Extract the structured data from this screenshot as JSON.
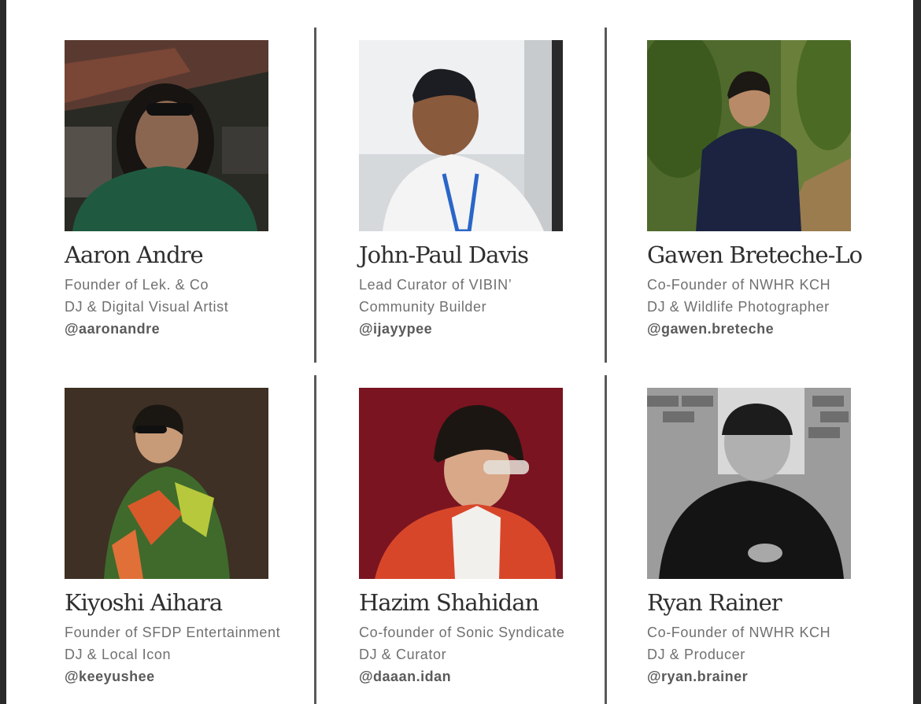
{
  "colors": {
    "page_background": "#ffffff",
    "name_text": "#2f2f2f",
    "role_text": "#707070",
    "handle_text": "#5a5a5a",
    "divider": "#5a5a5a"
  },
  "people": [
    {
      "name": "Aaron Andre",
      "role1": "Founder of Lek. & Co",
      "role2": "DJ & Digital Visual Artist",
      "handle": "@aaronandre"
    },
    {
      "name": "John-Paul Davis",
      "role1": "Lead Curator of VIBIN’",
      "role2": "Community Builder",
      "handle": "@ijayypee"
    },
    {
      "name": "Gawen Breteche-Lo",
      "role1": "Co-Founder of NWHR KCH",
      "role2": "DJ & Wildlife Photographer",
      "handle": "@gawen.breteche"
    },
    {
      "name": "Kiyoshi Aihara",
      "role1": "Founder of SFDP Entertainment",
      "role2": "DJ & Local Icon",
      "handle": "@keeyushee"
    },
    {
      "name": "Hazim Shahidan",
      "role1": "Co-founder of Sonic Syndicate",
      "role2": "DJ & Curator",
      "handle": "@daaan.idan"
    },
    {
      "name": "Ryan Rainer",
      "role1": "Co-Founder of NWHR KCH",
      "role2": "DJ & Producer",
      "handle": "@ryan.brainer"
    }
  ]
}
